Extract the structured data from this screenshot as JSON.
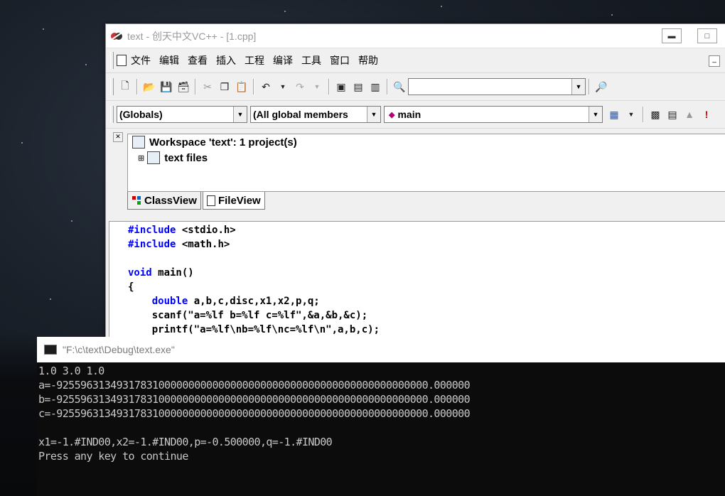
{
  "vc_window": {
    "title": "text - 创天中文VC++ - [1.cpp]",
    "menu": [
      "文件",
      "编辑",
      "查看",
      "插入",
      "工程",
      "编译",
      "工具",
      "窗口",
      "帮助"
    ],
    "wizard": {
      "class_combo": "(Globals)",
      "members_combo": "(All global members",
      "function_combo": "main"
    },
    "workspace": {
      "root": "Workspace 'text': 1 project(s)",
      "child": "text files",
      "tabs": [
        "ClassView",
        "FileView"
      ]
    },
    "code_lines": [
      {
        "kw": "#include",
        "rest": " <stdio.h>"
      },
      {
        "kw": "#include",
        "rest": " <math.h>"
      },
      {
        "kw": "",
        "rest": ""
      },
      {
        "kw": "void",
        "rest": " main()"
      },
      {
        "kw": "",
        "rest": "{"
      },
      {
        "kw": "    double",
        "rest": " a,b,c,disc,x1,x2,p,q;"
      },
      {
        "kw": "",
        "rest": "    scanf(\"a=%lf b=%lf c=%lf\",&a,&b,&c);"
      },
      {
        "kw": "",
        "rest": "    printf(\"a=%lf\\nb=%lf\\nc=%lf\\n\",a,b,c);"
      }
    ]
  },
  "console": {
    "title": "\"F:\\c\\text\\Debug\\text.exe\"",
    "lines": [
      "1.0 3.0 1.0",
      "a=-92559631349317831000000000000000000000000000000000000000000000.000000",
      "b=-92559631349317831000000000000000000000000000000000000000000000.000000",
      "c=-92559631349317831000000000000000000000000000000000000000000000.000000",
      "",
      "x1=-1.#IND00,x2=-1.#IND00,p=-0.500000,q=-1.#IND00",
      "Press any key to continue"
    ]
  }
}
